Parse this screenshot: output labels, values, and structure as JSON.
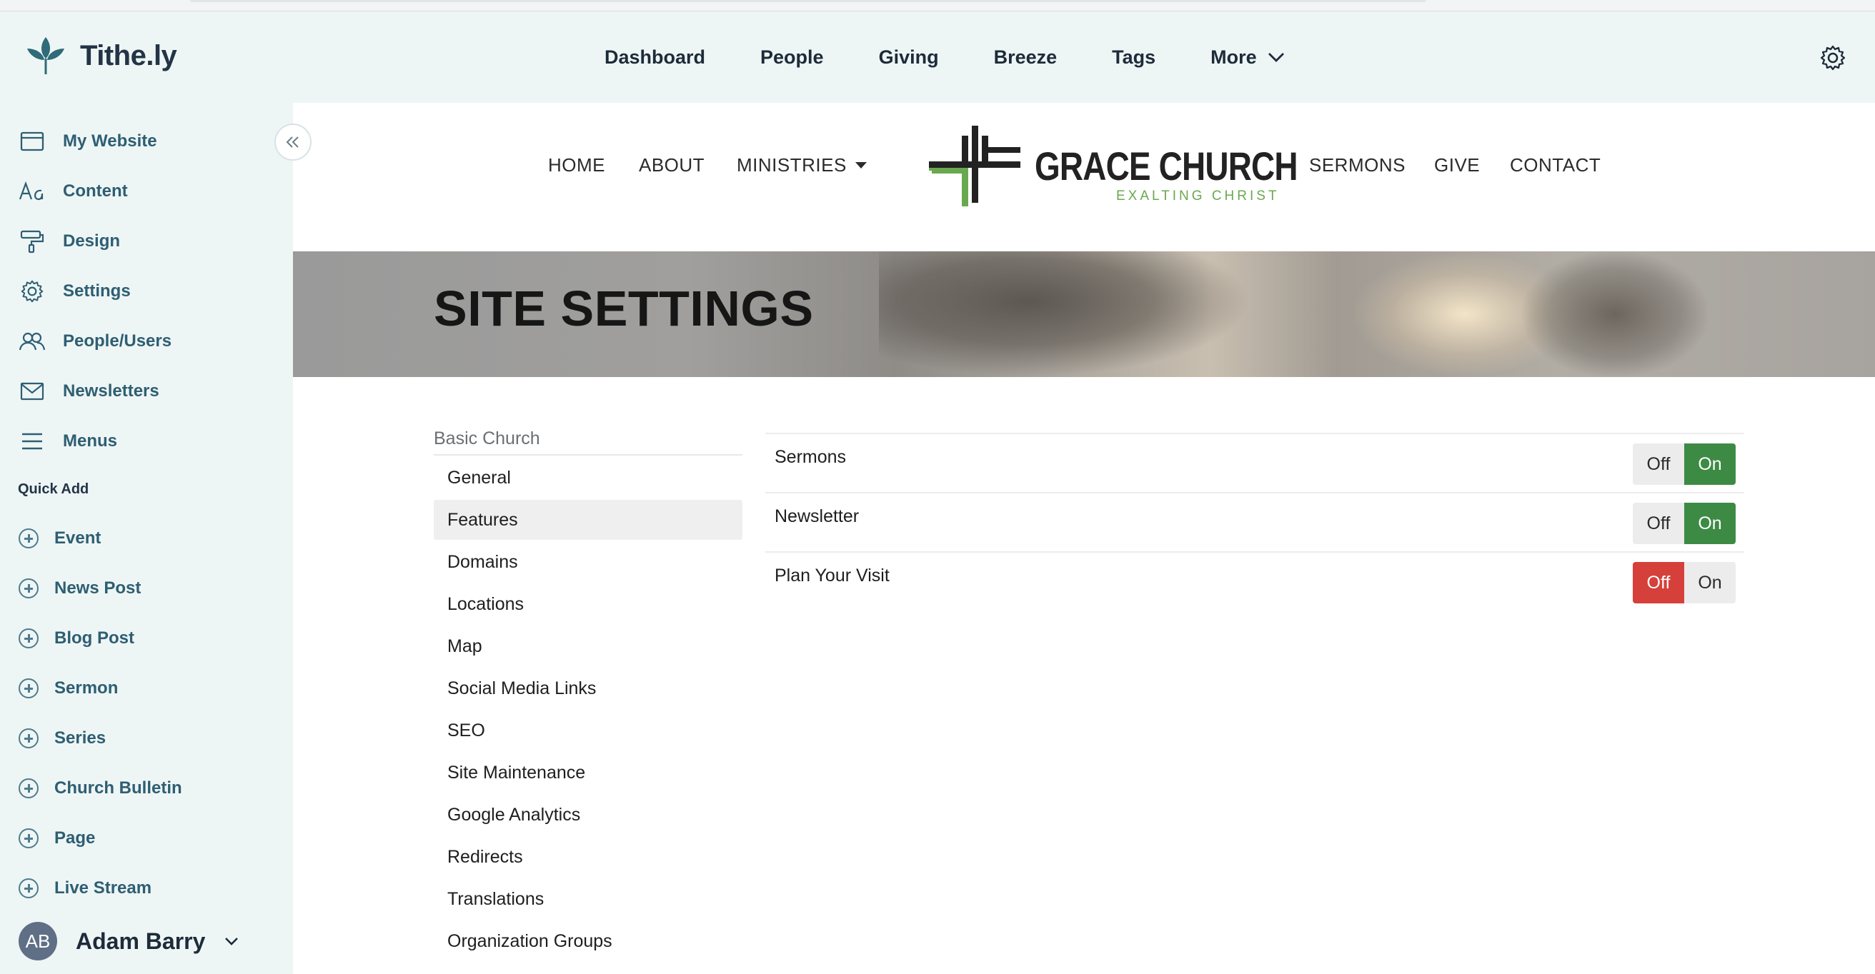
{
  "app": {
    "name": "Tithe.ly",
    "nav": [
      "Dashboard",
      "People",
      "Giving",
      "Breeze",
      "Tags",
      "More"
    ]
  },
  "sidebar": {
    "items": [
      {
        "label": "My Website",
        "icon": "browser-window-icon"
      },
      {
        "label": "Content",
        "icon": "font-aa-icon"
      },
      {
        "label": "Design",
        "icon": "paint-roller-icon"
      },
      {
        "label": "Settings",
        "icon": "gear-icon"
      },
      {
        "label": "People/Users",
        "icon": "users-icon"
      },
      {
        "label": "Newsletters",
        "icon": "envelope-icon"
      },
      {
        "label": "Menus",
        "icon": "hamburger-menu-icon"
      }
    ],
    "quick_add_label": "Quick Add",
    "quick_add": [
      "Event",
      "News Post",
      "Blog Post",
      "Sermon",
      "Series",
      "Church Bulletin",
      "Page",
      "Live Stream"
    ],
    "user": {
      "initials": "AB",
      "name": "Adam Barry"
    }
  },
  "site": {
    "nav_left": [
      "HOME",
      "ABOUT",
      "MINISTRIES"
    ],
    "nav_right": [
      "SERMONS",
      "GIVE",
      "CONTACT"
    ],
    "brand_title": "GRACE CHURCH",
    "brand_sub": "EXALTING CHRIST",
    "hero_title": "SITE SETTINGS"
  },
  "settings": {
    "group_title": "Basic Church",
    "nav": [
      "General",
      "Features",
      "Domains",
      "Locations",
      "Map",
      "Social Media Links",
      "SEO",
      "Site Maintenance",
      "Google Analytics",
      "Redirects",
      "Translations",
      "Organization Groups"
    ],
    "active": "Features",
    "features": [
      {
        "label": "Sermons",
        "state": "on"
      },
      {
        "label": "Newsletter",
        "state": "on"
      },
      {
        "label": "Plan Your Visit",
        "state": "off"
      }
    ],
    "off_label": "Off",
    "on_label": "On"
  },
  "colors": {
    "brand_teal": "#2e5e73",
    "toggle_on": "#3d8a45",
    "toggle_off": "#d6403a",
    "cross_green": "#6aa84f"
  }
}
